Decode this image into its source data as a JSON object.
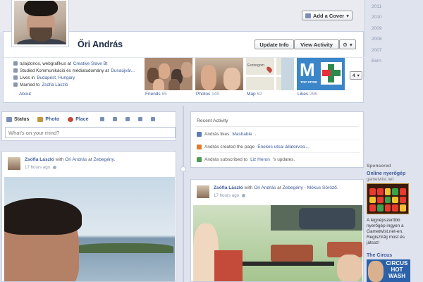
{
  "header": {
    "add_cover_label": "Add a Cover"
  },
  "years": [
    "2011",
    "2010",
    "2009",
    "2008",
    "2007",
    "Born"
  ],
  "profile": {
    "name": "Őri András",
    "update_info_label": "Update Info",
    "view_activity_label": "View Activity",
    "about_label": "About",
    "about_items": [
      {
        "icon": "briefcase-icon",
        "text": "tulajdonos, webgrafikus at ",
        "link": "Creative Slave Bt"
      },
      {
        "icon": "graduation-icon",
        "text": "Studied Kommunikáció és médiatudomány at ",
        "link": "Dunaújvár..."
      },
      {
        "icon": "home-icon",
        "text": "Lives in ",
        "link": "Budapest, Hungary"
      },
      {
        "icon": "heart-icon",
        "text": "Married to ",
        "link": "Zsófia László"
      }
    ],
    "apps": [
      {
        "label": "Friends",
        "count": "85"
      },
      {
        "label": "Photos",
        "count": "149"
      },
      {
        "label": "Map",
        "count": "62",
        "town": "Esztergom"
      },
      {
        "label": "Likes",
        "count": "296",
        "tile_text": "TOP STORI"
      }
    ],
    "more_count": "4"
  },
  "composer": {
    "tabs": [
      "Status",
      "Photo",
      "Place"
    ],
    "placeholder": "What's on your mind?"
  },
  "recent": {
    "title": "Recent Activity",
    "items": [
      {
        "text": "András likes ",
        "link": "Mashable",
        "suffix": "."
      },
      {
        "text": "András created the page ",
        "link": "Énekes utcai állatorvosi...",
        "suffix": ""
      },
      {
        "text": "András subscribed to ",
        "link": "Liz Heron",
        "suffix": "'s updates."
      }
    ]
  },
  "posts": [
    {
      "author": "Zsófia László",
      "with_text": " with ",
      "with": "Őri András",
      "at_text": " at ",
      "place": "Zebegény",
      "end": ".",
      "time": "17 hours ago"
    },
    {
      "author": "Zsófia László",
      "with_text": " with ",
      "with": "Őri András",
      "at_text": " at ",
      "place": "Zebegény - Mókus Söröző",
      "end": ".",
      "time": "17 hours ago"
    }
  ],
  "sponsored": {
    "label": "Sponsored",
    "ads": [
      {
        "title": "Online nyerőgép",
        "url": "gametwist.net",
        "text": "A legnépszerűbb nyerőgép ingyen a Gametwist.net-en. Regisztrálj most és játssz!"
      },
      {
        "title": "The Circus",
        "img_text": "CIRCUS HOT WASH"
      }
    ]
  }
}
